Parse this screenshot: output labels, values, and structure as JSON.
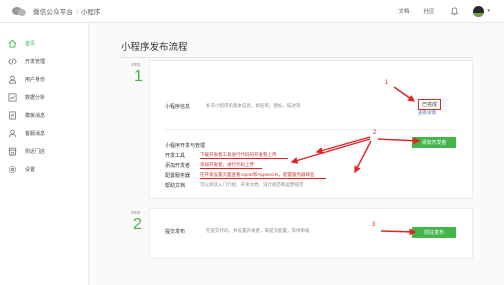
{
  "header": {
    "platform_title": "微信公众平台",
    "separator": "|",
    "section_title": "小程序",
    "links": [
      "文档",
      "社区"
    ],
    "bell_icon": "bell-icon",
    "avatar_icon": "avatar-icon",
    "caret": "▾"
  },
  "sidebar": {
    "items": [
      {
        "label": "首页",
        "icon": "home-icon",
        "active": true
      },
      {
        "label": "开发管理",
        "icon": "code-icon"
      },
      {
        "label": "用户身份",
        "icon": "user-icon"
      },
      {
        "label": "数据分析",
        "icon": "chart-icon"
      },
      {
        "label": "模板消息",
        "icon": "document-icon"
      },
      {
        "label": "客服消息",
        "icon": "person-icon"
      },
      {
        "label": "附近门店",
        "icon": "store-icon"
      },
      {
        "label": "设置",
        "icon": "gear-icon"
      }
    ]
  },
  "main": {
    "title": "小程序发布流程",
    "step1": {
      "step_label": "step",
      "number": "1",
      "info_label": "小程序信息",
      "info_desc": "补充小程序的基本信息，如名称、图标、描述等",
      "info_status": "已完成",
      "info_link": "查看详情",
      "tools_header": "小程序开发与管理",
      "tools": [
        {
          "label": "开发工具",
          "desc": "下载开发者工具进行代码的开发和上传"
        },
        {
          "label": "添加开发者",
          "desc": "添加开发者，进行代码上传"
        },
        {
          "label": "配置服务器",
          "desc": "在开发设置页面查看AppID和AppSecret，配置服务器域名"
        },
        {
          "label": "帮助文档",
          "desc": "可以阅读入门介绍、开发文档、设计规范和运营规范"
        }
      ],
      "add_dev_button": "添加开发者"
    },
    "step2": {
      "step_label": "step",
      "number": "2",
      "publish_label": "提交发布",
      "publish_desc": "在提交代码，并设置开发者，来提交配置，等待审核",
      "submit_button": "前往发布"
    },
    "annotations": {
      "a1": "1",
      "a2": "2",
      "a3": "3"
    }
  },
  "colors": {
    "accent": "#44b549",
    "annotation": "#e02424"
  }
}
